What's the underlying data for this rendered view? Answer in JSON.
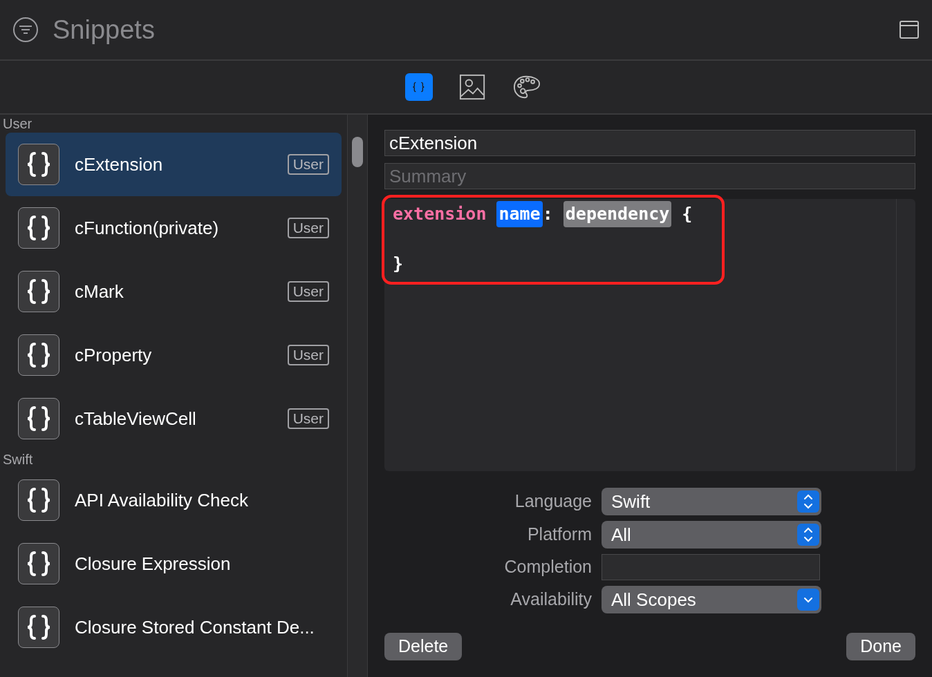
{
  "window": {
    "title": "Snippets"
  },
  "tabs": [
    {
      "kind": "code",
      "selected": true
    },
    {
      "kind": "image",
      "selected": false
    },
    {
      "kind": "palette",
      "selected": false
    }
  ],
  "sections": [
    {
      "title": "User",
      "items": [
        {
          "name": "cExtension",
          "badge": "User",
          "selected": true
        },
        {
          "name": "cFunction(private)",
          "badge": "User",
          "selected": false
        },
        {
          "name": "cMark",
          "badge": "User",
          "selected": false
        },
        {
          "name": "cProperty",
          "badge": "User",
          "selected": false
        },
        {
          "name": "cTableViewCell",
          "badge": "User",
          "selected": false
        }
      ]
    },
    {
      "title": "Swift",
      "items": [
        {
          "name": "API Availability Check",
          "selected": false
        },
        {
          "name": "Closure Expression",
          "selected": false
        },
        {
          "name": "Closure Stored Constant De...",
          "selected": false
        }
      ]
    }
  ],
  "detail": {
    "title_value": "cExtension",
    "summary_placeholder": "Summary",
    "code_lines": [
      [
        {
          "kind": "keyword",
          "text": "extension"
        },
        {
          "kind": "token_selected",
          "text": "name"
        },
        {
          "kind": "plain",
          "text": ": "
        },
        {
          "kind": "token",
          "text": "dependency"
        },
        {
          "kind": "plain",
          "text": " {"
        }
      ],
      [
        {
          "kind": "plain",
          "text": "}"
        }
      ]
    ],
    "fields": [
      {
        "label": "Language",
        "kind": "stepper",
        "value": "Swift"
      },
      {
        "label": "Platform",
        "kind": "stepper",
        "value": "All"
      },
      {
        "label": "Completion",
        "kind": "text"
      },
      {
        "label": "Availability",
        "kind": "dropdown",
        "value": "All Scopes"
      }
    ],
    "buttons": [
      "Delete",
      "Done"
    ]
  }
}
